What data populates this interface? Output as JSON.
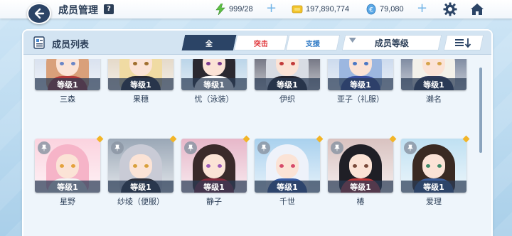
{
  "header": {
    "title": "成员管理",
    "help": "?",
    "ap": "999/28",
    "credits": "197,890,774",
    "pyroxene": "79,080"
  },
  "panel": {
    "title": "成员列表",
    "tabs": [
      "全",
      "突击",
      "支援"
    ],
    "sort_label": "成员等级"
  },
  "colors": {
    "accent": "#2b4466",
    "striker": "#e0383c",
    "special": "#2f7ac5",
    "gold": "#f2b528"
  },
  "members_row1": [
    {
      "level": "等级1",
      "name": "三森",
      "hair": "#d9a07a",
      "bg": "#c9d5e8",
      "outfit": "#b33a3a",
      "eye": "#6a86c7"
    },
    {
      "level": "等级1",
      "name": "果穗",
      "hair": "#f0dba3",
      "bg": "#d9c9b2",
      "outfit": "#2a2a35",
      "eye": "#a07030"
    },
    {
      "level": "等级1",
      "name": "忧（泳装）",
      "hair": "#2a2830",
      "bg": "#9ec3df",
      "outfit": "#ffffff",
      "eye": "#7b3a8f"
    },
    {
      "level": "等级1",
      "name": "伊织",
      "hair": "#d8dce4",
      "bg": "#3c3f52",
      "outfit": "#24242f",
      "eye": "#c23a3a"
    },
    {
      "level": "等级1",
      "name": "亚子（礼服）",
      "hair": "#9cb7e0",
      "bg": "#b7cbe6",
      "outfit": "#3a4fa0",
      "eye": "#4b78c4"
    },
    {
      "level": "等级1",
      "name": "濑名",
      "hair": "#f3f1ea",
      "bg": "#4a5b7a",
      "outfit": "#2f3a5a",
      "eye": "#d6a34a"
    }
  ],
  "members_row2": [
    {
      "level": "等级1",
      "name": "星野",
      "hair": "#f6b4c8",
      "bg": "#fbd3df",
      "outfit": "#f4f4f4",
      "eye": "#e4a23c"
    },
    {
      "level": "等级1",
      "name": "纱绫（便服）",
      "hair": "#c9cbd6",
      "bg": "#9aa7b6",
      "outfit": "#2d2f3a",
      "eye": "#d9a03c"
    },
    {
      "level": "等级1",
      "name": "静子",
      "hair": "#3a2a2a",
      "bg": "#e7b7c9",
      "outfit": "#8a2a3c",
      "eye": "#9a5ab8"
    },
    {
      "level": "等级1",
      "name": "千世",
      "hair": "#eef2fa",
      "bg": "#a9d1ee",
      "outfit": "#3b5fa8",
      "eye": "#d64a6a"
    },
    {
      "level": "等级1",
      "name": "椿",
      "hair": "#1f1f26",
      "bg": "#d9c2c0",
      "outfit": "#c23838",
      "eye": "#7a4a3a"
    },
    {
      "level": "等级1",
      "name": "爱理",
      "hair": "#3a2a22",
      "bg": "#bfe0f2",
      "outfit": "#3c5e9a",
      "eye": "#3e8a6a"
    }
  ]
}
